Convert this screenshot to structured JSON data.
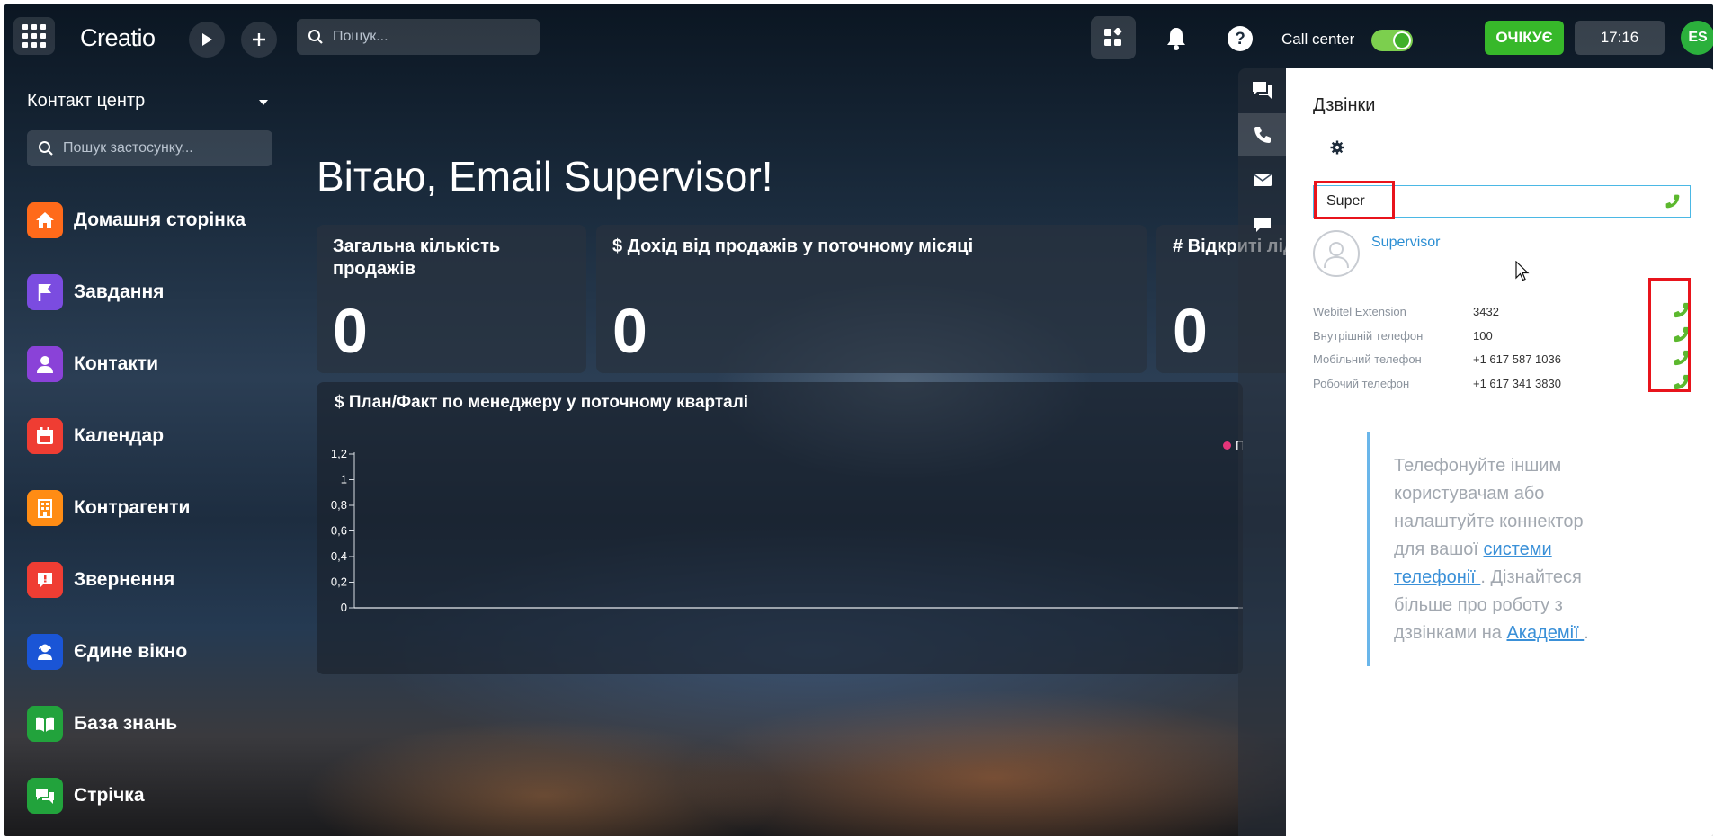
{
  "topbar": {
    "logo": "Creatio",
    "search_placeholder": "Пошук...",
    "call_center_label": "Call center",
    "status_label": "ОЧІКУЄ",
    "time": "17:16",
    "avatar_initials": "ES"
  },
  "sidebar": {
    "workspace_title": "Контакт центр",
    "search_placeholder": "Пошук застосунку...",
    "items": [
      {
        "label": "Домашня сторінка",
        "icon": "home-icon",
        "color": "#ff6a1a"
      },
      {
        "label": "Завдання",
        "icon": "flag-icon",
        "color": "#7b4ce0"
      },
      {
        "label": "Контакти",
        "icon": "person-icon",
        "color": "#8a42d8"
      },
      {
        "label": "Календар",
        "icon": "calendar-icon",
        "color": "#ef3d33"
      },
      {
        "label": "Контрагенти",
        "icon": "building-icon",
        "color": "#ff8c14"
      },
      {
        "label": "Звернення",
        "icon": "alert-bubble-icon",
        "color": "#ef3d33"
      },
      {
        "label": "Єдине вікно",
        "icon": "agent-icon",
        "color": "#1a55d6"
      },
      {
        "label": "База знань",
        "icon": "book-icon",
        "color": "#22a33c"
      },
      {
        "label": "Стрічка",
        "icon": "chat-icon",
        "color": "#22a33c"
      }
    ]
  },
  "main": {
    "greeting": "Вітаю, Email Supervisor!",
    "cards": [
      {
        "title": "Загальна кількість продажів",
        "value": "0"
      },
      {
        "title": "$ Дохід від продажів у поточному місяці",
        "value": "0"
      },
      {
        "title": "# Відкриті лід",
        "value": "0"
      }
    ]
  },
  "chart_data": {
    "type": "bar",
    "title": "$ План/Факт по менеджеру у поточному кварталі",
    "categories": [],
    "series": [
      {
        "name": "План",
        "values": []
      }
    ],
    "ylim": [
      0,
      1.2
    ],
    "yticks": [
      "0",
      "0,2",
      "0,4",
      "0,6",
      "0,8",
      "1",
      "1,2"
    ],
    "xlabel": "",
    "ylabel": "",
    "legend_position": "top-right",
    "series_colors": [
      "#e5357a"
    ]
  },
  "calls": {
    "title": "Дзвінки",
    "input_value": "Super",
    "contact_name": "Supervisor",
    "phones": [
      {
        "label": "Webitel Extension",
        "value": "3432"
      },
      {
        "label": "Внутрішній телефон",
        "value": "100"
      },
      {
        "label": "Мобільний телефон",
        "value": "+1 617 587 1036"
      },
      {
        "label": "Робочий телефон",
        "value": "+1 617 341 3830"
      }
    ],
    "info_text_before": "Телефонуйте іншим користувачам або налаштуйте коннектор для вашої ",
    "info_link1": "системи телефонії ",
    "info_text_middle": ". Дізнайтеся більше про роботу з дзвінками на ",
    "info_link2": "Академії ",
    "info_text_after": "."
  },
  "colors": {
    "accent_green": "#37b82a",
    "link_blue": "#2b8ed3",
    "highlight_red": "#e8141c",
    "phone_green": "#5cb82e"
  }
}
